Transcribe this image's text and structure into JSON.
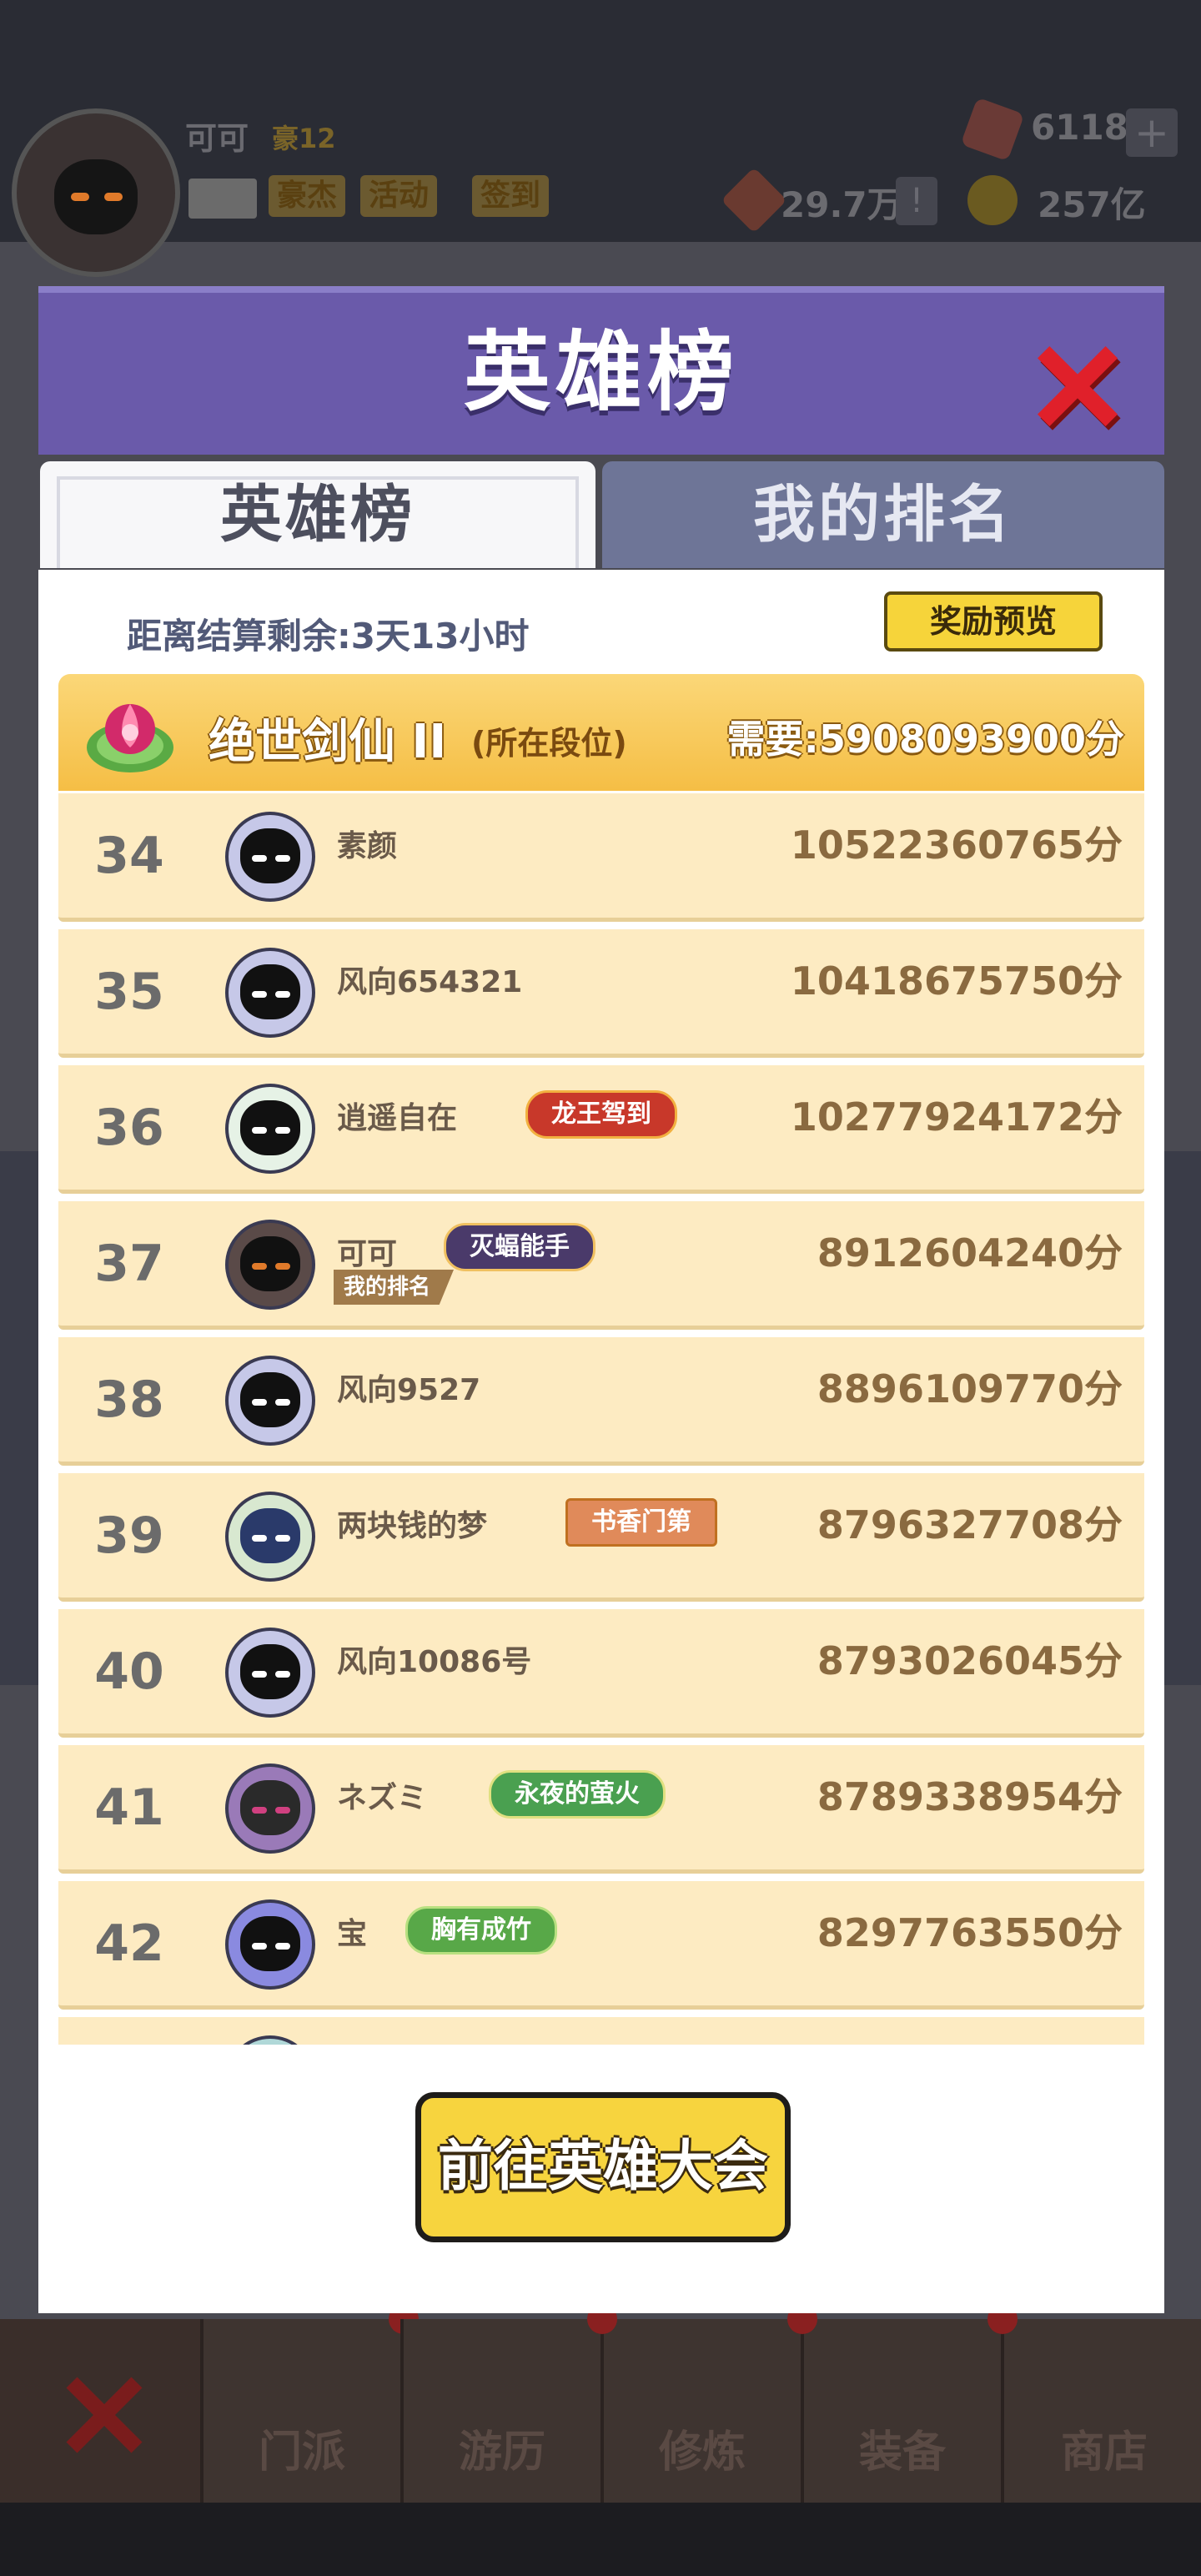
{
  "header": {
    "player_name": "可可",
    "rank_label": "豪12",
    "buttons": [
      "豪杰",
      "活动",
      "签到"
    ],
    "gems": "6118",
    "power": "29.7万",
    "coins": "257亿"
  },
  "modal": {
    "title": "英雄榜",
    "tabs": {
      "active": "英雄榜",
      "inactive": "我的排名"
    },
    "countdown": "距离结算剩余:3天13小时",
    "reward_button": "奖励预览",
    "tier": {
      "name": "绝世剑仙 II",
      "note": "(所在段位)",
      "requirement": "需要:5908093900分"
    },
    "my_rank_label": "我的排名",
    "rows": [
      {
        "rank": "34",
        "name": "素颜",
        "score": "10522360765分",
        "badge": ""
      },
      {
        "rank": "35",
        "name": "风向654321",
        "score": "10418675750分",
        "badge": ""
      },
      {
        "rank": "36",
        "name": "逍遥自在",
        "score": "10277924172分",
        "badge": "龙王驾到"
      },
      {
        "rank": "37",
        "name": "可可",
        "score": "8912604240分",
        "badge": "灭蝠能手"
      },
      {
        "rank": "38",
        "name": "风向9527",
        "score": "8896109770分",
        "badge": ""
      },
      {
        "rank": "39",
        "name": "两块钱的梦",
        "score": "8796327708分",
        "badge": "书香门第"
      },
      {
        "rank": "40",
        "name": "风向10086号",
        "score": "8793026045分",
        "badge": ""
      },
      {
        "rank": "41",
        "name": "ネズミ",
        "score": "8789338954分",
        "badge": "永夜的萤火"
      },
      {
        "rank": "42",
        "name": "宝",
        "score": "8297763550分",
        "badge": "胸有成竹"
      }
    ],
    "go_button": "前往英雄大会"
  },
  "nav": {
    "items": [
      "门派",
      "游历",
      "修炼",
      "装备",
      "商店"
    ]
  },
  "colors": {
    "accent_purple": "#6a5aaa",
    "row_bg": "#fdebc2",
    "tier_gold": "#f5be45",
    "button_yellow": "#f7d43e",
    "close_red": "#e0202a"
  }
}
